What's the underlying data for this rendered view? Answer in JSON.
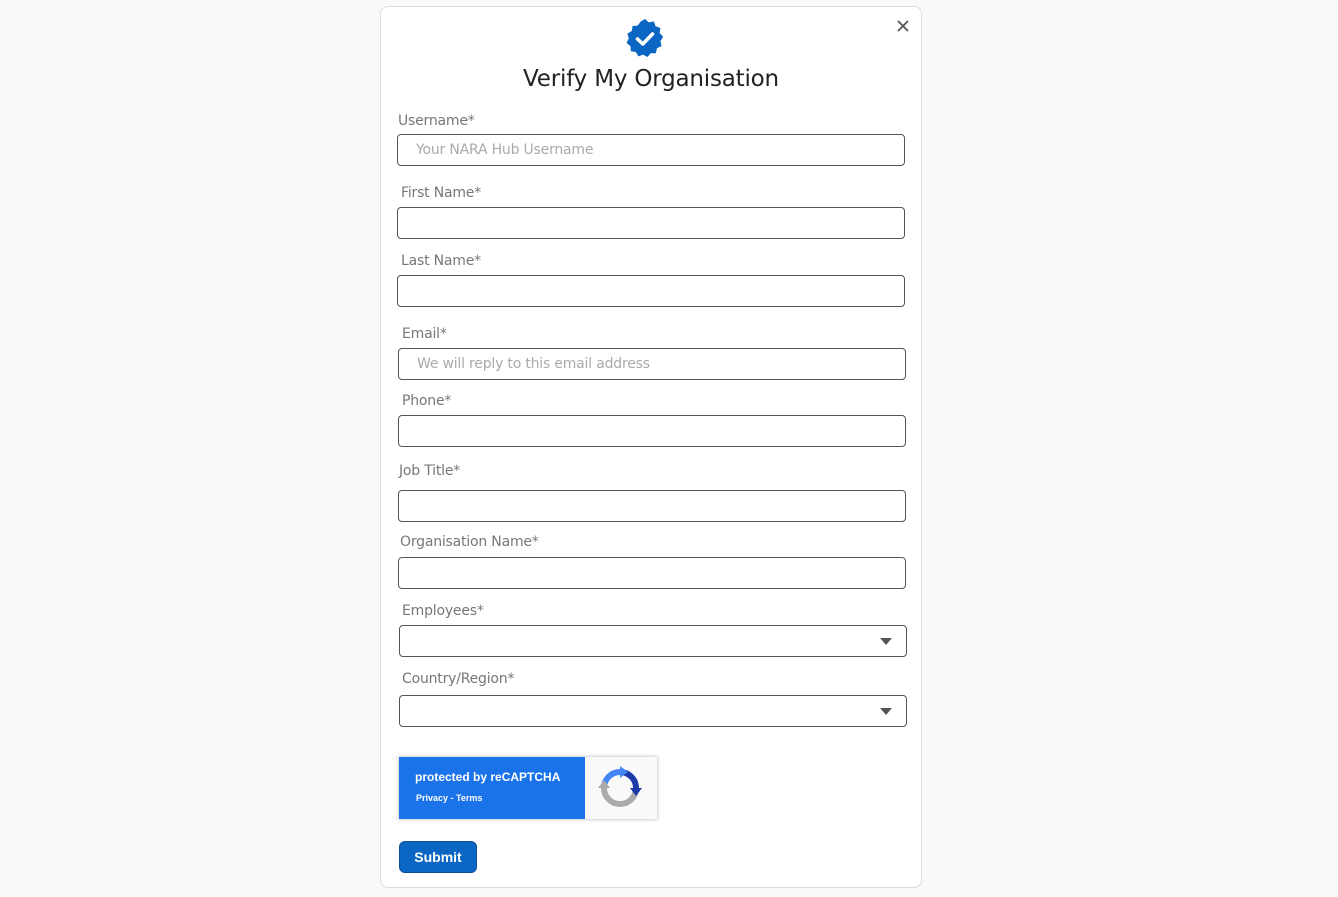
{
  "form": {
    "title": "Verify My Organisation",
    "icon": "verified-badge-icon",
    "accent_color": "#0a66c2",
    "fields": {
      "username": {
        "label": "Username*",
        "placeholder": "Your NARA Hub Username",
        "value": ""
      },
      "first_name": {
        "label": "First Name*",
        "value": ""
      },
      "last_name": {
        "label": "Last Name*",
        "value": ""
      },
      "email": {
        "label": "Email*",
        "placeholder": "We will reply to this email address",
        "value": ""
      },
      "phone": {
        "label": "Phone*",
        "value": ""
      },
      "job_title": {
        "label": "Job Title*",
        "value": ""
      },
      "organisation_name": {
        "label": "Organisation  Name*",
        "value": ""
      },
      "employees": {
        "label": "Employees*",
        "selected": ""
      },
      "country_region": {
        "label": "Country/Region*",
        "selected": ""
      }
    },
    "captcha": {
      "protected_text": "protected by reCAPTCHA",
      "privacy_link": "Privacy",
      "separator": " - ",
      "terms_link": "Terms"
    },
    "submit_label": "Submit",
    "close_icon": "close-icon"
  }
}
